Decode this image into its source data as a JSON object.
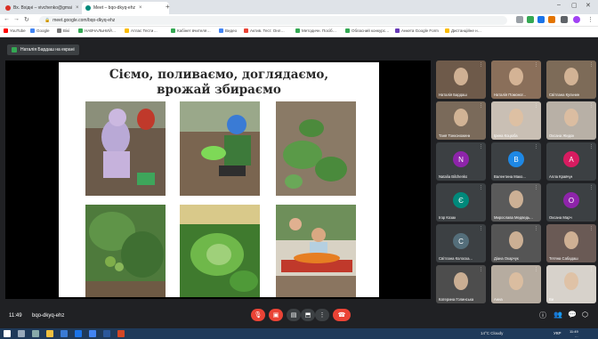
{
  "browser": {
    "tabs": [
      {
        "label": "Вх. Вхідні – vivchenko@gmai",
        "active": false,
        "color": "#d93025"
      },
      {
        "label": "Meet – bqo-dkyq-ehz",
        "active": true,
        "color": "#00897b"
      }
    ],
    "new_tab": "+",
    "url": "meet.google.com/bqo-dkyq-ehz",
    "bookmarks": [
      "YouTube",
      "Google",
      "Вікі",
      "НАВЧАЛЬНИЙ…",
      "Атлас Тести…",
      "Кабінет вчителя…",
      "Видео",
      "Актив. Тест. Онл…",
      "Методичн. Посіб…",
      "Обласний конкурс…",
      "Анкета Google Form",
      "Дистанційне н…"
    ]
  },
  "meet": {
    "presenter_label": "Наталія Бардаш на екрані",
    "slide": {
      "title_line1": "Сіємо, поливаємо, доглядаємо,",
      "title_line2": "врожай збираємо"
    },
    "participants": [
      {
        "name": "Наталія Бардаш",
        "type": "video",
        "bg": "#6e5a4a"
      },
      {
        "name": "Наталія Помоног...",
        "type": "video",
        "bg": "#8a6f5a"
      },
      {
        "name": "Світлана Кульчин",
        "type": "video",
        "bg": "#7d6b58"
      },
      {
        "name": "Таня Тонконоженк",
        "type": "video",
        "bg": "#7a6a5a"
      },
      {
        "name": "Ірина Коцюба",
        "type": "video",
        "bg": "#c9bfb4"
      },
      {
        "name": "Оксана Жидок",
        "type": "video",
        "bg": "#b8b0a6"
      },
      {
        "name": "Natalia Bilchenko",
        "type": "avatar",
        "initial": "N",
        "color": "#8e24aa"
      },
      {
        "name": "Валентина Мако...",
        "type": "avatar",
        "initial": "В",
        "color": "#1e88e5"
      },
      {
        "name": "Алла Кравчук",
        "type": "avatar",
        "initial": "А",
        "color": "#d81b60"
      },
      {
        "name": "Ігор Козак",
        "type": "avatar",
        "initial": "Є",
        "color": "#00897b"
      },
      {
        "name": "Мирослава Медведь...",
        "type": "photo",
        "bg": "#5a5a5a"
      },
      {
        "name": "Оксана Марч",
        "type": "avatar",
        "initial": "О",
        "color": "#8e24aa"
      },
      {
        "name": "Світлана Колоска...",
        "type": "avatar",
        "initial": "С",
        "color": "#546e7a"
      },
      {
        "name": "Діана Окарчук",
        "type": "photo",
        "bg": "#555555"
      },
      {
        "name": "Тетяна Сабадаш",
        "type": "photo",
        "bg": "#6a5a55"
      },
      {
        "name": "Катерина Голинська",
        "type": "photo",
        "bg": "#4d4d4d"
      },
      {
        "name": "Анна",
        "type": "video",
        "bg": "#b6aca0"
      },
      {
        "name": "Ви",
        "type": "self",
        "bg": "#d7d2cb"
      }
    ],
    "time": "11:49",
    "meeting_code": "bqo-dkyq-ehz"
  },
  "taskbar": {
    "weather": "14°C Cloudy",
    "lang": "УКР",
    "clock_time": "11:49",
    "clock_date": "…"
  }
}
